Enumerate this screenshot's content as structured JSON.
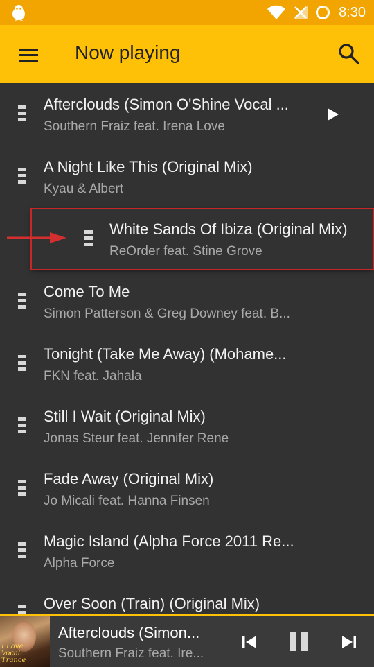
{
  "status_bar": {
    "time": "8:30",
    "icons": [
      "notification-penguin-icon",
      "wifi-icon",
      "signal-icon",
      "battery-charging-icon"
    ],
    "bar_color": "#f2a500"
  },
  "app_bar": {
    "title": "Now playing",
    "menu_icon": "menu-icon",
    "search_icon": "search-icon",
    "bar_color": "#ffc107"
  },
  "playlist": {
    "tracks": [
      {
        "title": "Afterclouds (Simon O'Shine Vocal ...",
        "artist": "Southern Fraiz feat. Irena Love",
        "playing": true
      },
      {
        "title": "A Night Like This (Original Mix)",
        "artist": "Kyau & Albert"
      },
      {
        "title": "White Sands Of Ibiza (Original Mix)",
        "artist": "ReOrder feat. Stine Grove",
        "dragging": true
      },
      {
        "title": "Come To Me",
        "artist": "Simon Patterson & Greg Downey feat. B..."
      },
      {
        "title": "Tonight (Take Me Away) (Mohame...",
        "artist": "FKN feat. Jahala"
      },
      {
        "title": "Still I Wait (Original Mix)",
        "artist": "Jonas Steur feat. Jennifer Rene"
      },
      {
        "title": "Fade Away (Original Mix)",
        "artist": "Jo Micali feat. Hanna Finsen"
      },
      {
        "title": "Magic Island (Alpha Force 2011 Re...",
        "artist": "Alpha Force"
      },
      {
        "title": "Over Soon (Train) (Original Mix)",
        "artist": ""
      }
    ],
    "highlight_color": "#c62828"
  },
  "now_playing": {
    "title": "Afterclouds (Simon...",
    "artist": "Southern Fraiz feat. Ire...",
    "album_art_text": "I Love Vocal Trance",
    "controls": [
      "skip-previous-icon",
      "pause-icon",
      "skip-next-icon"
    ]
  }
}
